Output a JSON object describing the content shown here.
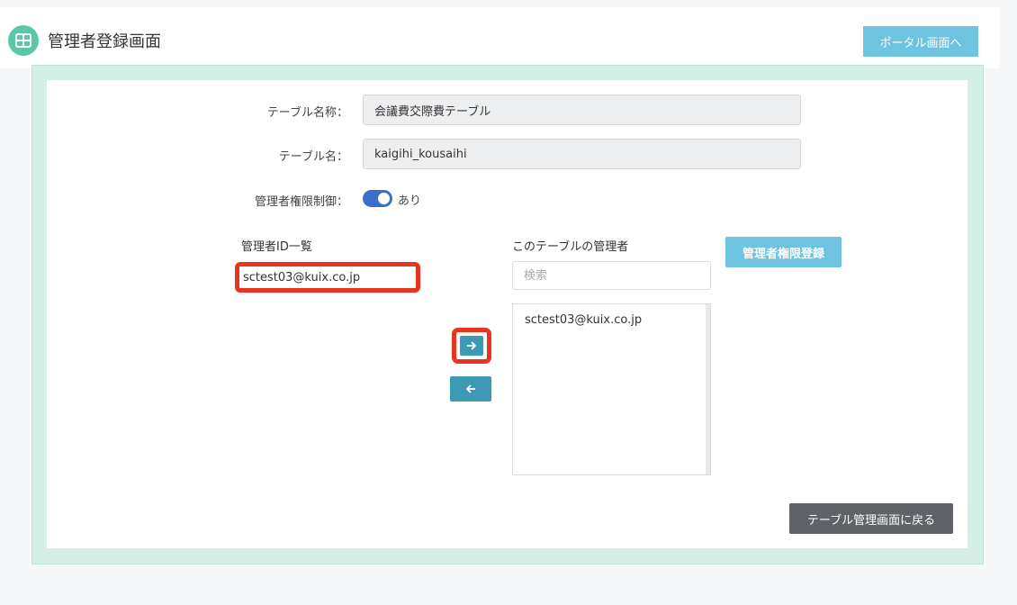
{
  "header": {
    "title": "管理者登録画面",
    "portal_button_label": "ポータル画面へ"
  },
  "form": {
    "table_name_label": "テーブル名称：",
    "table_name_value": "会議費交際費テーブル",
    "table_id_label": "テーブル名：",
    "table_id_value": "kaigihi_kousaihi",
    "permission_label": "管理者権限制御：",
    "permission_toggle_on": true,
    "permission_state_text": "あり"
  },
  "lists": {
    "admin_id_list_label": "管理者ID一覧",
    "admin_id_items": [
      "sctest03@kuix.co.jp"
    ],
    "table_admins_label": "このテーブルの管理者",
    "search_placeholder": "検索",
    "table_admin_items": [
      "sctest03@kuix.co.jp"
    ]
  },
  "buttons": {
    "register_label": "管理者権限登録",
    "back_label": "テーブル管理画面に戻る"
  },
  "icons": {
    "title_icon": "table-icon",
    "add_icon": "arrow-right-icon",
    "remove_icon": "arrow-left-icon"
  },
  "colors": {
    "accent": "#6ec3e0",
    "arrow_button": "#3e99b4",
    "highlight": "#e8331f",
    "toggle": "#3a6fc9",
    "panel_green": "#d5efe7"
  }
}
